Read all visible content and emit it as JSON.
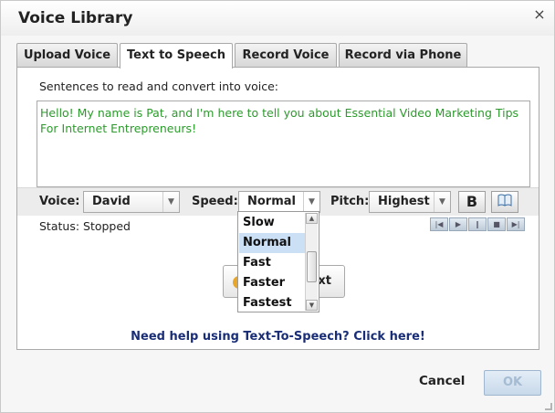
{
  "dialog": {
    "title": "Voice Library",
    "close_glyph": "×"
  },
  "tabs": [
    {
      "label": "Upload Voice",
      "active": false
    },
    {
      "label": "Text to Speech",
      "active": true
    },
    {
      "label": "Record Voice",
      "active": false
    },
    {
      "label": "Record via Phone",
      "active": false
    }
  ],
  "tts": {
    "instruction": "Sentences to read and convert into voice:",
    "text_line1": "Hello! My name is Pat, and I'm here to tell you about Essential Video Marketing Tips",
    "text_line2": "For Internet Entrepreneurs!",
    "text_color": "#2d9a2d"
  },
  "controls": {
    "voice_label": "Voice:",
    "voice_value": "David",
    "speed_label": "Speed:",
    "speed_value": "Normal",
    "pitch_label": "Pitch:",
    "pitch_value": "Highest",
    "bold_button": "B",
    "dictionary_icon": "book-icon"
  },
  "speed_options": [
    "Slow",
    "Normal",
    "Fast",
    "Faster",
    "Fastest"
  ],
  "speed_selected": "Normal",
  "status": {
    "text": "Status: Stopped"
  },
  "player_icons": [
    "skip-back-icon",
    "play-icon",
    "pause-icon",
    "stop-icon",
    "skip-forward-icon"
  ],
  "generate_button": {
    "label_fragment": "xt"
  },
  "help_link": "Need help using Text-To-Speech? Click here!",
  "footer": {
    "cancel": "Cancel",
    "ok": "OK"
  },
  "colors": {
    "help_link": "#1a2e78",
    "selected_option": "#cce0f5",
    "ok_disabled_text": "#a5bcd2"
  }
}
